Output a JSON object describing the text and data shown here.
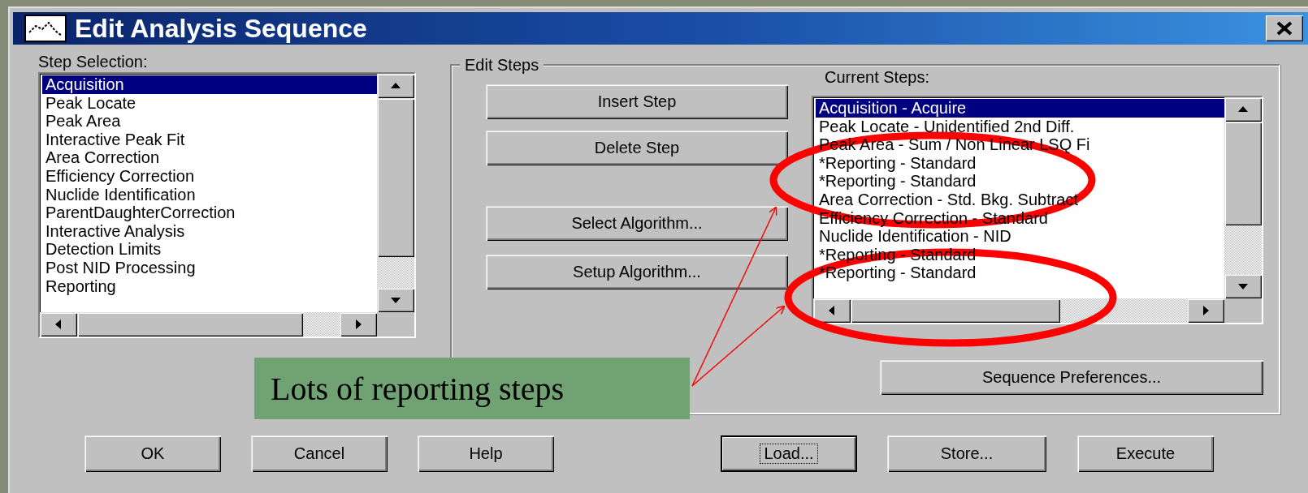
{
  "window": {
    "title": "Edit Analysis Sequence"
  },
  "step_selection": {
    "label": "Step Selection:",
    "items": [
      {
        "label": "Acquisition",
        "selected": true
      },
      {
        "label": "Peak Locate",
        "selected": false
      },
      {
        "label": "Peak Area",
        "selected": false
      },
      {
        "label": "Interactive Peak Fit",
        "selected": false
      },
      {
        "label": "Area Correction",
        "selected": false
      },
      {
        "label": "Efficiency Correction",
        "selected": false
      },
      {
        "label": "Nuclide Identification",
        "selected": false
      },
      {
        "label": "ParentDaughterCorrection",
        "selected": false
      },
      {
        "label": "Interactive Analysis",
        "selected": false
      },
      {
        "label": "Detection Limits",
        "selected": false
      },
      {
        "label": "Post NID Processing",
        "selected": false
      },
      {
        "label": "Reporting",
        "selected": false
      }
    ]
  },
  "edit_steps": {
    "title": "Edit Steps",
    "buttons": [
      {
        "label": "Insert Step"
      },
      {
        "label": "Delete Step"
      },
      {
        "label": "Select Algorithm..."
      },
      {
        "label": "Setup Algorithm..."
      }
    ],
    "current_steps": {
      "label": "Current Steps:",
      "items": [
        {
          "label": "Acquisition - Acquire",
          "selected": true
        },
        {
          "label": "Peak Locate - Unidentified 2nd Diff.",
          "selected": false
        },
        {
          "label": "Peak Area - Sum / Non Linear LSQ Fi",
          "selected": false
        },
        {
          "label": "*Reporting - Standard",
          "selected": false
        },
        {
          "label": "*Reporting - Standard",
          "selected": false
        },
        {
          "label": "Area Correction - Std. Bkg. Subtract",
          "selected": false
        },
        {
          "label": "Efficiency Correction - Standard",
          "selected": false
        },
        {
          "label": "Nuclide Identification - NID",
          "selected": false
        },
        {
          "label": "*Reporting - Standard",
          "selected": false
        },
        {
          "label": "*Reporting - Standard",
          "selected": false
        }
      ]
    },
    "preferences_button": "Sequence Preferences..."
  },
  "buttons": [
    {
      "label": "OK",
      "focused": false
    },
    {
      "label": "Cancel",
      "focused": false
    },
    {
      "label": "Help",
      "focused": false
    },
    {
      "label": "Load...",
      "focused": true
    },
    {
      "label": "Store...",
      "focused": false
    },
    {
      "label": "Execute",
      "focused": false
    }
  ],
  "annotation": {
    "text": "Lots of reporting steps"
  }
}
